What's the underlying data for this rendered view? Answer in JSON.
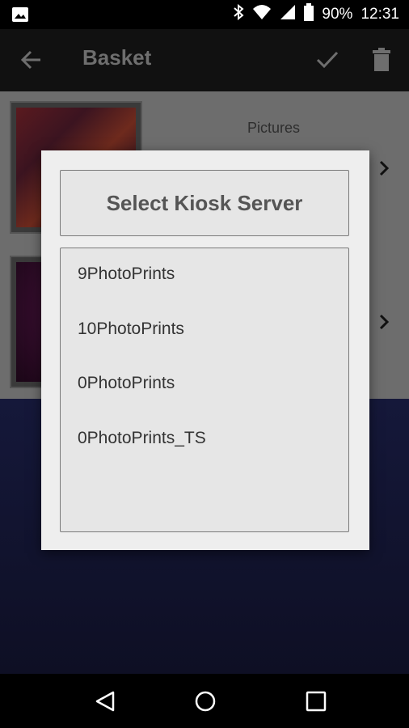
{
  "status_bar": {
    "battery": "90%",
    "time": "12:31",
    "icons": [
      "image-notification-icon",
      "bluetooth-icon",
      "wifi-icon",
      "signal-icon",
      "battery-icon"
    ]
  },
  "app_bar": {
    "title": "Basket",
    "icons": [
      "back-arrow-icon",
      "check-icon",
      "trash-icon"
    ]
  },
  "basket": {
    "pictures_label": "Pictures"
  },
  "dialog": {
    "title": "Select Kiosk Server",
    "servers": [
      "9PhotoPrints",
      "10PhotoPrints",
      "0PhotoPrints",
      "0PhotoPrints_TS"
    ]
  },
  "nav_bar": {
    "icons": [
      "nav-back-icon",
      "nav-home-icon",
      "nav-recents-icon"
    ]
  },
  "colors": {
    "scrim": "#6d6d6d",
    "dialog_bg": "#eeeeee",
    "lower_bg": "#15183a"
  }
}
